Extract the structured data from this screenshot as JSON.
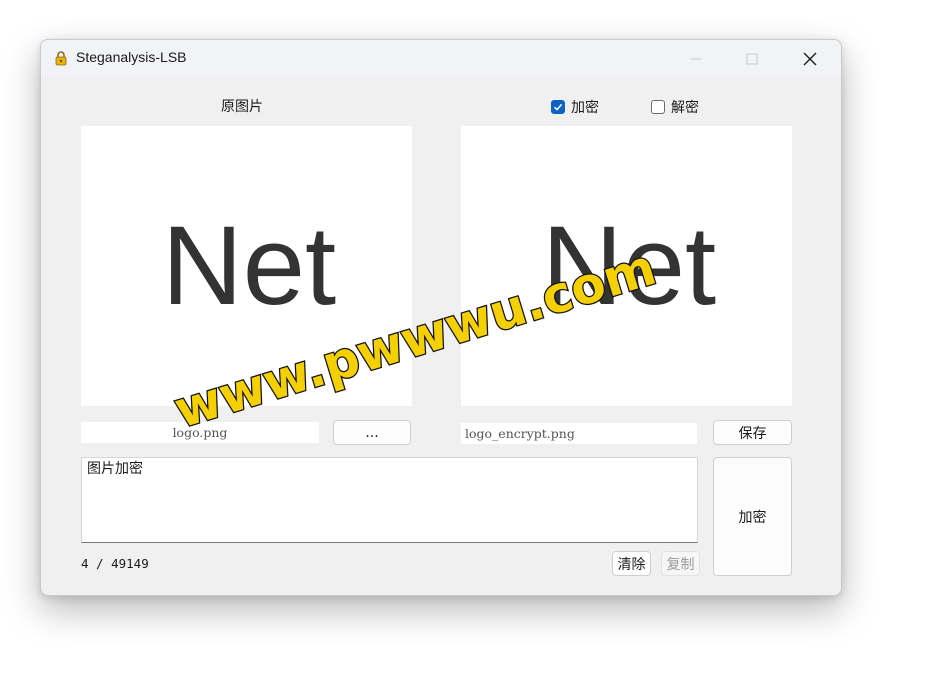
{
  "window": {
    "title": "Steganalysis-LSB"
  },
  "labels": {
    "original_image": "原图片"
  },
  "mode": {
    "encrypt_label": "加密",
    "encrypt_checked": true,
    "decrypt_label": "解密",
    "decrypt_checked": false
  },
  "images": {
    "left_text": "Net",
    "right_text": "Net"
  },
  "inputs": {
    "source_file": "logo.png",
    "output_file": "logo_encrypt.png"
  },
  "buttons": {
    "browse": "...",
    "save": "保存",
    "encrypt": "加密",
    "clear": "清除",
    "copy": "复制"
  },
  "message": {
    "text": "图片加密",
    "counter": "4 / 49149"
  },
  "watermark": {
    "text": "www.pwwwu.com"
  },
  "colors": {
    "accent": "#0a62c4",
    "watermark_fill": "#f5d000",
    "watermark_stroke": "#111111"
  },
  "icons": {
    "app": "lock-icon",
    "minimize": "minimize-icon",
    "maximize": "maximize-icon",
    "close": "close-icon",
    "check": "check-icon"
  }
}
